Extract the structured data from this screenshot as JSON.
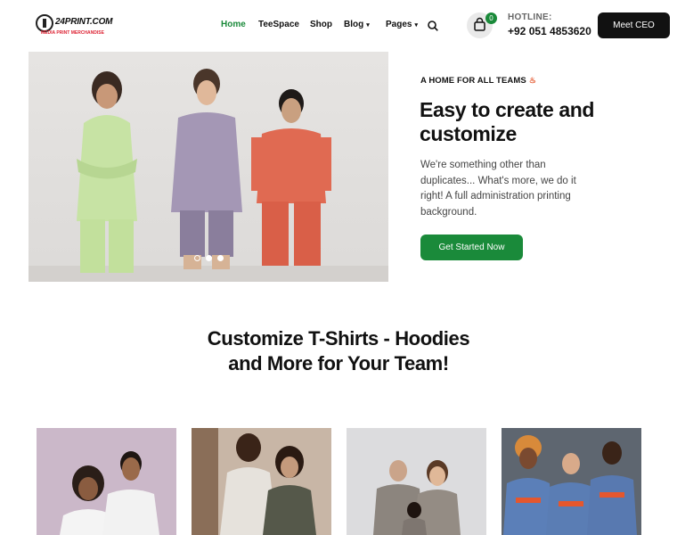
{
  "header": {
    "logo_text": "24PRINT.COM",
    "logo_tagline": "MEDIA PRINT MERCHANDISE",
    "nav": [
      {
        "label": "Home",
        "active": true,
        "has_dropdown": false
      },
      {
        "label": "TeeSpace",
        "active": false,
        "has_dropdown": false
      },
      {
        "label": "Shop",
        "active": false,
        "has_dropdown": false
      },
      {
        "label": "Blog",
        "active": false,
        "has_dropdown": true
      },
      {
        "label": "Pages",
        "active": false,
        "has_dropdown": true
      }
    ],
    "cart_count": "0",
    "hotline_label": "HOTLINE:",
    "hotline_number": "+92 051 4853620",
    "cta_label": "Meet CEO"
  },
  "hero": {
    "eyebrow": "A HOME FOR ALL TEAMS",
    "title": "Easy to create and customize",
    "description": "We're something other than duplicates... What's more, we do it right! A full administration printing background.",
    "button_label": "Get Started Now",
    "slides_total": 3,
    "active_slide": 1
  },
  "section": {
    "title": "Customize T-Shirts - Hoodies and More for Your Team!"
  },
  "colors": {
    "accent_green": "#1a8a3a",
    "dark": "#111111",
    "flame": "#e4572e"
  }
}
